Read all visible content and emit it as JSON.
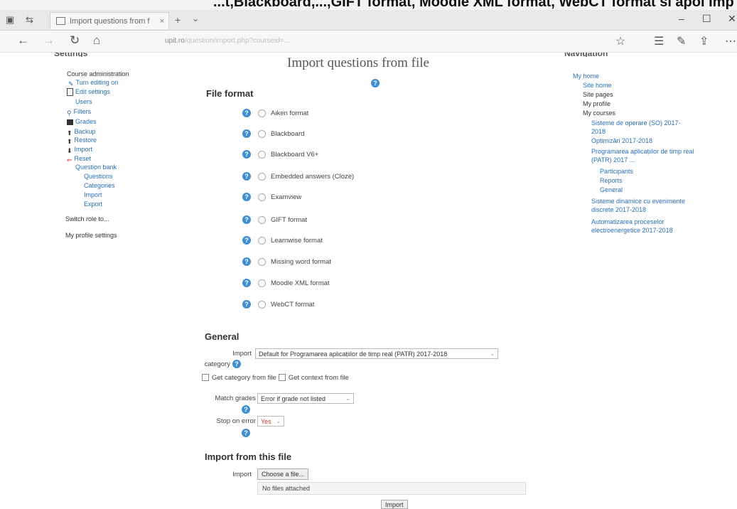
{
  "banner_text": "...t,Blackboard,...,GIFT format, Moodle XML format, WebCT format si apoi Imp",
  "tab": {
    "title": "Import questions from f",
    "close": "×"
  },
  "new_tab": "+",
  "url": {
    "host": "upit.ro",
    "path": "/question/import.php?courseid=..."
  },
  "page": {
    "title": "Import questions from file"
  },
  "settings": {
    "title": "Settings",
    "course_admin": "Course administration",
    "items": [
      {
        "label": "Turn editing on"
      },
      {
        "label": "Edit settings"
      },
      {
        "label": "Users"
      },
      {
        "label": "Filters"
      },
      {
        "label": "Grades"
      },
      {
        "label": "Backup"
      },
      {
        "label": "Restore"
      },
      {
        "label": "Import"
      },
      {
        "label": "Reset"
      },
      {
        "label": "Question bank"
      },
      {
        "label": "Questions"
      },
      {
        "label": "Categories"
      },
      {
        "label": "Import"
      },
      {
        "label": "Export"
      }
    ],
    "switch_role": "Switch role to...",
    "profile": "My profile settings"
  },
  "navigation": {
    "title": "Navigation",
    "items": [
      {
        "label": "My home"
      },
      {
        "label": "Site home"
      },
      {
        "label": "Site pages"
      },
      {
        "label": "My profile"
      },
      {
        "label": "My courses"
      },
      {
        "label": "Sisteme de operare (SO) 2017-2018"
      },
      {
        "label": "Optimizări 2017-2018"
      },
      {
        "label": "Programarea aplicațiilor de timp real (PATR) 2017 ..."
      },
      {
        "label": "Participants"
      },
      {
        "label": "Reports"
      },
      {
        "label": "General"
      },
      {
        "label": "Sisteme dinamice cu evenimente discrete 2017-2018"
      },
      {
        "label": "Automatizarea proceselor electroenergetice 2017-2018"
      }
    ]
  },
  "file_format": {
    "heading": "File format",
    "options": [
      "Aiken format",
      "Blackboard",
      "Blackboard V6+",
      "Embedded answers (Cloze)",
      "Examview",
      "GIFT format",
      "Learnwise format",
      "Missing word format",
      "Moodle XML format",
      "WebCT format"
    ]
  },
  "general": {
    "heading": "General",
    "import_label": "Import",
    "category_label": "category",
    "category_value": "Default for Programarea aplicațiilor de timp real (PATR) 2017-2018",
    "get_category": "Get category from file",
    "get_context": "Get context from file",
    "match_grades_label": "Match grades",
    "match_grades_value": "Error if grade not listed",
    "stop_on_error_label": "Stop on error",
    "stop_on_error_value": "Yes"
  },
  "import_file": {
    "heading": "Import from this file",
    "label": "Import",
    "choose_button": "Choose a file...",
    "no_files": "No files attached",
    "submit": "Import"
  },
  "help_glyph": "?"
}
